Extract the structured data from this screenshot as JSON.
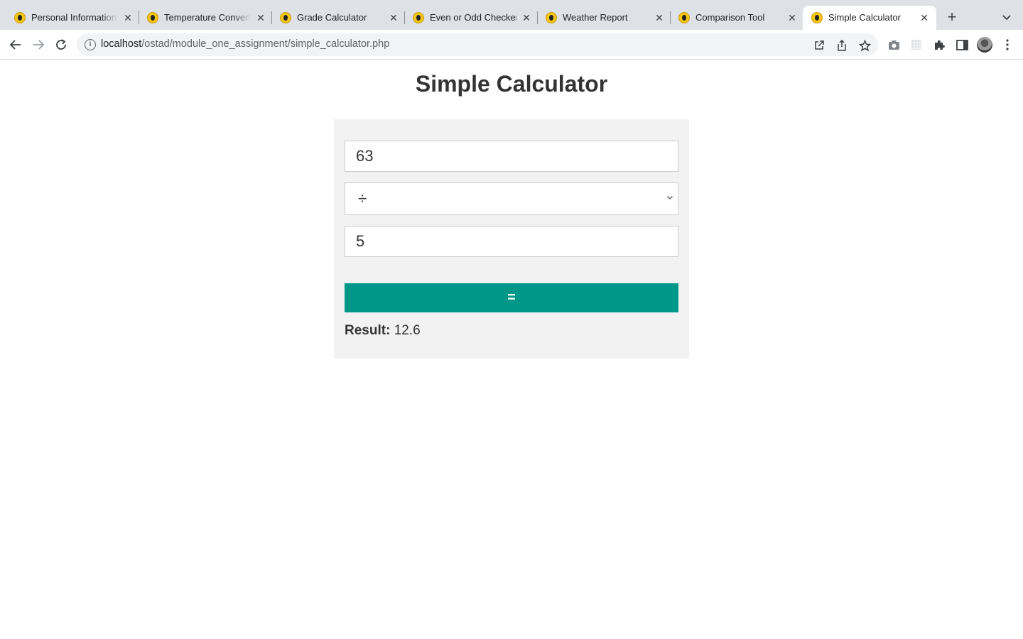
{
  "browser": {
    "tabs": [
      {
        "title": "Personal Information F"
      },
      {
        "title": "Temperature Converter"
      },
      {
        "title": "Grade Calculator"
      },
      {
        "title": "Even or Odd Checker"
      },
      {
        "title": "Weather Report"
      },
      {
        "title": "Comparison Tool"
      },
      {
        "title": "Simple Calculator",
        "active": true
      }
    ],
    "url_host": "localhost",
    "url_path": "/ostad/module_one_assignment/simple_calculator.php"
  },
  "page": {
    "title": "Simple Calculator",
    "first_number": "63",
    "operator": "÷",
    "second_number": "5",
    "equals_label": "=",
    "result_label": "Result:",
    "result_value": "12.6"
  },
  "colors": {
    "button": "#009688",
    "card_background": "#f2f2f2"
  }
}
